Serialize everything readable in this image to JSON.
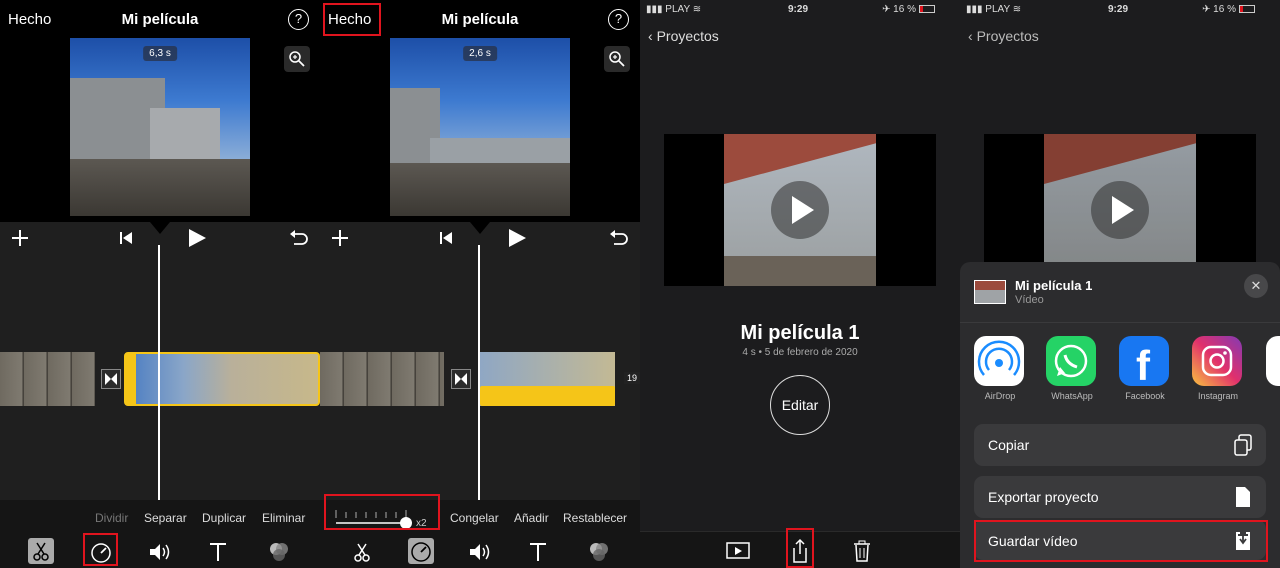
{
  "editor": {
    "done_label": "Hecho",
    "title": "Mi película",
    "help_label": "?",
    "clip_duration_1": "6,3 s",
    "clip_duration_2": "2,6 s",
    "speed_multiplier": "x2",
    "clip_count": "19",
    "tools_left": [
      "Dividir",
      "Separar",
      "Duplicar",
      "Eliminar"
    ],
    "tools_right": [
      "Congelar",
      "Añadir",
      "Restablecer"
    ]
  },
  "status_bar": {
    "carrier": "PLAY",
    "time": "9:29",
    "battery": "16 %"
  },
  "project_view": {
    "back_label": "Proyectos",
    "project_title": "Mi película 1",
    "project_meta": "4 s • 5 de febrero de 2020",
    "edit_button": "Editar"
  },
  "share_sheet": {
    "item_title": "Mi película 1",
    "item_subtitle": "Vídeo",
    "apps": [
      "AirDrop",
      "WhatsApp",
      "Facebook",
      "Instagram"
    ],
    "actions": [
      "Copiar",
      "Exportar proyecto",
      "Guardar vídeo"
    ]
  },
  "colors": {
    "highlight": "#e0141e",
    "clip_selected": "#f5c518",
    "whatsapp": "#25d366",
    "facebook": "#1877f2"
  }
}
